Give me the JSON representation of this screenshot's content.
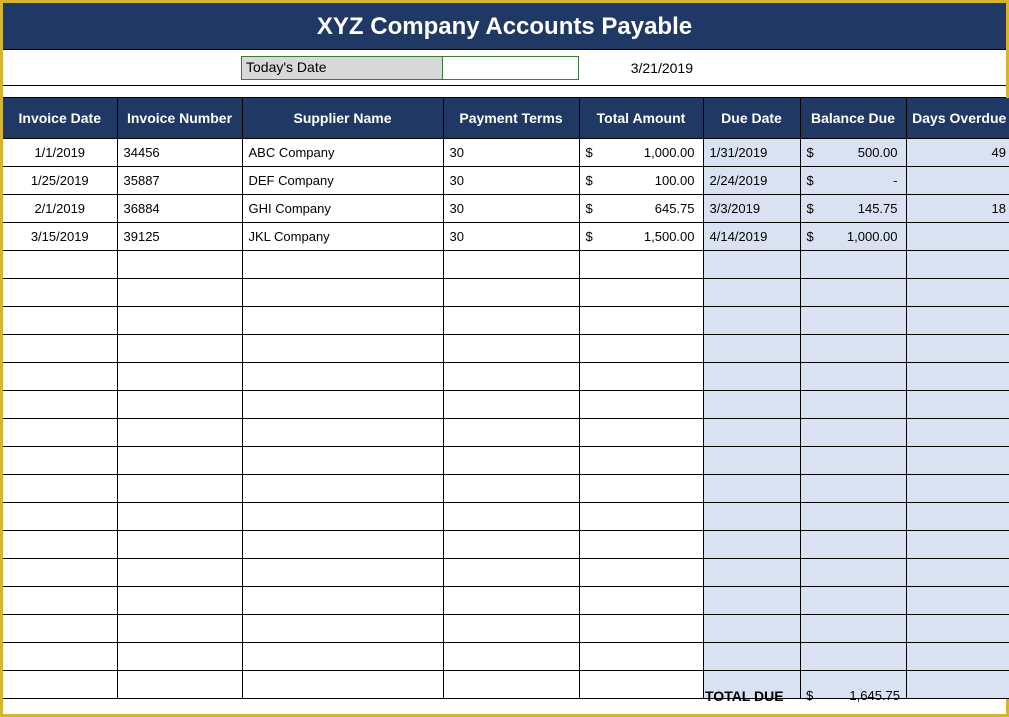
{
  "title": "XYZ Company Accounts Payable",
  "date_label": "Today's Date",
  "date_value": "3/21/2019",
  "columns": {
    "invoice_date": "Invoice Date",
    "invoice_number": "Invoice Number",
    "supplier_name": "Supplier Name",
    "payment_terms": "Payment Terms",
    "total_amount": "Total Amount",
    "due_date": "Due Date",
    "balance_due": "Balance Due",
    "days_overdue": "Days Overdue"
  },
  "rows": [
    {
      "invoice_date": "1/1/2019",
      "invoice_number": "34456",
      "supplier": "ABC Company",
      "terms": "30",
      "total": "1,000.00",
      "due_date": "1/31/2019",
      "balance": "500.00",
      "overdue": "49"
    },
    {
      "invoice_date": "1/25/2019",
      "invoice_number": "35887",
      "supplier": "DEF Company",
      "terms": "30",
      "total": "100.00",
      "due_date": "2/24/2019",
      "balance": "-",
      "overdue": ""
    },
    {
      "invoice_date": "2/1/2019",
      "invoice_number": "36884",
      "supplier": "GHI Company",
      "terms": "30",
      "total": "645.75",
      "due_date": "3/3/2019",
      "balance": "145.75",
      "overdue": "18"
    },
    {
      "invoice_date": "3/15/2019",
      "invoice_number": "39125",
      "supplier": "JKL Company",
      "terms": "30",
      "total": "1,500.00",
      "due_date": "4/14/2019",
      "balance": "1,000.00",
      "overdue": ""
    }
  ],
  "empty_row_count": 16,
  "total_due_label": "TOTAL DUE",
  "total_due_value": "1,645.75",
  "currency_symbol": "$"
}
